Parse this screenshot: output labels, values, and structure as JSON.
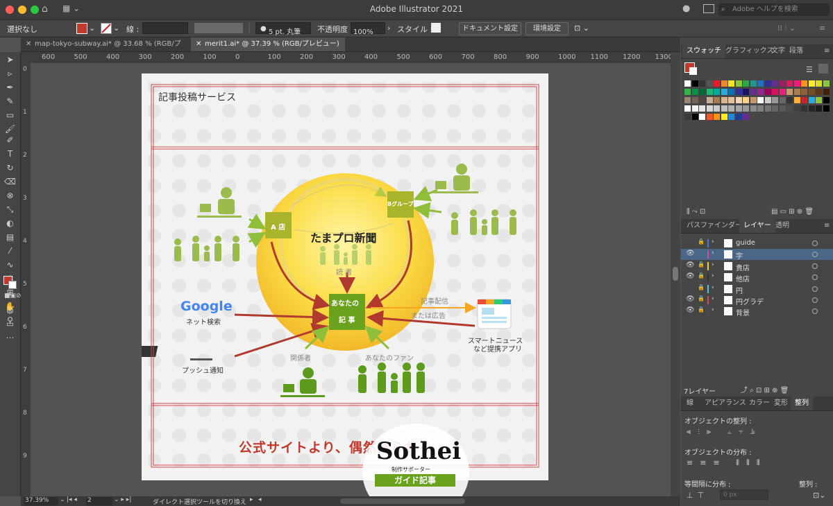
{
  "app": {
    "title": "Adobe Illustrator 2021",
    "search_placeholder": "Adobe ヘルプを検索"
  },
  "colors": {
    "accent_red": "#c0392b",
    "green": "#6aa21e",
    "yellow": "#f7d33a",
    "panel_bg": "#464646"
  },
  "controlbar": {
    "selection": "選択なし",
    "stroke_label": "線 :",
    "brush": "5 pt. 丸筆",
    "opacity_label": "不透明度 :",
    "opacity_value": "100%",
    "style_label": "スタイル :",
    "doc_settings": "ドキュメント設定",
    "prefs": "環境設定"
  },
  "tabs": [
    {
      "label": "map-tokyo-subway.ai* @ 33.68 % (RGB/プレビュー)"
    },
    {
      "label": "merit1.ai* @ 37.39 % (RGB/プレビュー)"
    }
  ],
  "ruler": {
    "h": [
      "600",
      "500",
      "400",
      "300",
      "200",
      "100",
      "0",
      "100",
      "200",
      "300",
      "400",
      "500",
      "600",
      "700",
      "800",
      "900",
      "1000",
      "1100",
      "1200",
      "1300"
    ],
    "v": [
      "0",
      "1",
      "2",
      "3",
      "4",
      "5",
      "6",
      "7",
      "8",
      "9"
    ]
  },
  "artwork": {
    "service_title": "記事投稿サービス",
    "newspaper": "たまプロ新聞",
    "shop_a": "A 店",
    "group_b": "Bグループ",
    "readers": "読 者",
    "your_article_1": "あなたの",
    "your_article_2": "記 事",
    "google": "Google",
    "net_search": "ネット検索",
    "push": "プッシュ通知",
    "related": "関係者",
    "fans": "あなたのファン",
    "distribution_1": "記事配信",
    "distribution_2": "または広告",
    "smartnews_1": "スマートニュース",
    "smartnews_2": "など提携アプリ",
    "tagline": "公式サイトより、偶然見られる",
    "logo_text": "Sothei",
    "logo_sub": "制作サポーター",
    "logo_badge": "ガイド記事"
  },
  "panels": {
    "swatch_tabs": [
      "スウォッチ",
      "グラフィックス",
      "文字",
      "段落"
    ],
    "layer_tabs": [
      "パスファインダー",
      "レイヤー",
      "透明"
    ],
    "layers": [
      {
        "name": "guide",
        "eye": false,
        "lock": true,
        "color": "#4a7bd6"
      },
      {
        "name": "字",
        "eye": true,
        "lock": false,
        "color": "#d64aa8"
      },
      {
        "name": "貴店",
        "eye": true,
        "lock": true,
        "color": "#e8d22a"
      },
      {
        "name": "他店",
        "eye": true,
        "lock": true,
        "color": "#333333"
      },
      {
        "name": "円",
        "eye": false,
        "lock": true,
        "color": "#4ac8d6"
      },
      {
        "name": "円グラデ",
        "eye": true,
        "lock": true,
        "color": "#d64a4a"
      },
      {
        "name": "背景",
        "eye": true,
        "lock": true,
        "color": "#4a4a4a"
      }
    ],
    "layer_count": "7レイヤー",
    "bottom_tabs": [
      "線",
      "アピアランス",
      "カラー",
      "変形",
      "整列"
    ],
    "align_objects": "オブジェクトの整列 :",
    "distribute_objects": "オブジェクトの分布 :",
    "equal_spacing": "等間隔に分布 :",
    "align_to": "整列 :",
    "spacing_value": "0 px"
  },
  "status": {
    "zoom": "37.39%",
    "page": "2",
    "tool_hint": "ダイレクト選択ツールを切り換え"
  }
}
